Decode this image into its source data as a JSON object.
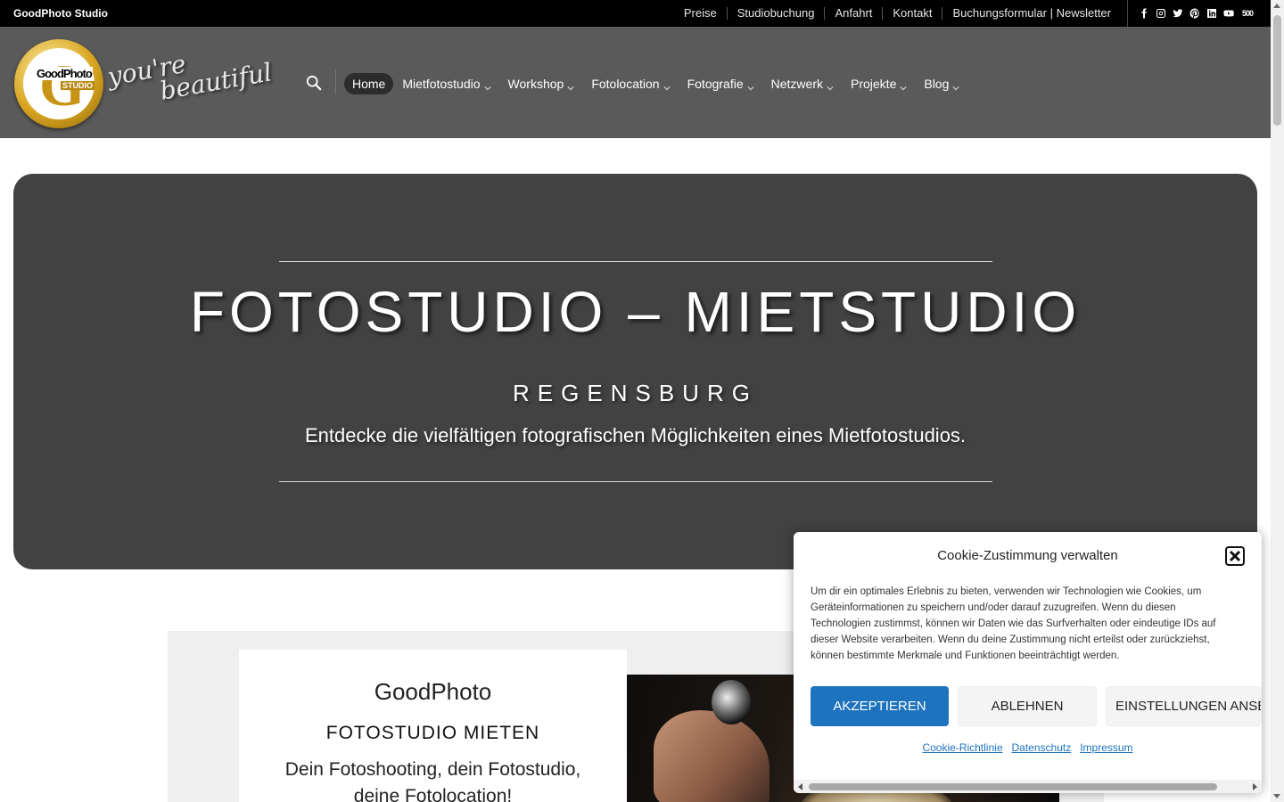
{
  "topbar": {
    "brand": "GoodPhoto Studio",
    "links": [
      "Preise",
      "Studiobuchung",
      "Anfahrt",
      "Kontakt",
      "Buchungsformular | Newsletter"
    ],
    "socials": [
      "facebook-icon",
      "instagram-icon",
      "twitter-icon",
      "pinterest-icon",
      "linkedin-icon",
      "youtube-icon",
      "500px-icon"
    ],
    "px_label": "500"
  },
  "header": {
    "logo_text": "GoodPhoto",
    "logo_studio": "STUDIO",
    "logo_g": "G",
    "tagline_1": "you're",
    "tagline_2": "beautiful",
    "nav": [
      "Home",
      "Mietfotostudio",
      "Workshop",
      "Fotolocation",
      "Fotografie",
      "Netzwerk",
      "Projekte",
      "Blog"
    ]
  },
  "hero": {
    "title": "FOTOSTUDIO – MIETSTUDIO",
    "subtitle": "REGENSBURG",
    "description": "Entdecke die vielfältigen fotografischen Möglichkeiten eines Mietfotostudios."
  },
  "card": {
    "brand": "GoodPhoto",
    "title": "FOTOSTUDIO MIETEN",
    "description": "Dein Fotoshooting, dein Fotostudio, deine Fotolocation!"
  },
  "cookie": {
    "title": "Cookie-Zustimmung verwalten",
    "text": "Um dir ein optimales Erlebnis zu bieten, verwenden wir Technologien wie Cookies, um Geräteinformationen zu speichern und/oder darauf zuzugreifen. Wenn du diesen Technologien zustimmst, können wir Daten wie das Surfverhalten oder eindeutige IDs auf dieser Website verarbeiten. Wenn du deine Zustimmung nicht erteilst oder zurückziehst, können bestimmte Merkmale und Funktionen beeinträchtigt werden.",
    "accept": "AKZEPTIEREN",
    "deny": "ABLEHNEN",
    "settings": "EINSTELLUNGEN ANSEHEN",
    "links": [
      "Cookie-Richtlinie",
      "Datenschutz",
      "Impressum"
    ]
  },
  "colors": {
    "accent": "#1e73be",
    "header_bg": "#5a5a5a",
    "hero_bg": "#424242",
    "gold": "#c89416"
  }
}
